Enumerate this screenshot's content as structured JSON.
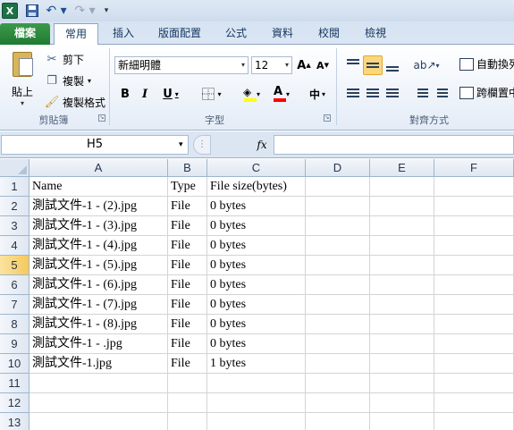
{
  "quick_access": {
    "logo_text": "X"
  },
  "tabs": [
    "檔案",
    "常用",
    "插入",
    "版面配置",
    "公式",
    "資料",
    "校閱",
    "檢視"
  ],
  "clipboard": {
    "paste_label": "貼上",
    "cut_label": "剪下",
    "copy_label": "複製",
    "format_painter_label": "複製格式",
    "group_label": "剪貼簿"
  },
  "font": {
    "name": "新細明體",
    "size": "12",
    "bold_label": "B",
    "italic_label": "I",
    "underline_label": "U",
    "grow_label": "A",
    "shrink_label": "A",
    "font_color_label": "A",
    "group_label": "字型",
    "fill_color": "#ffff00",
    "font_color": "#ff0000"
  },
  "alignment": {
    "wrap_text_label": "自動換列",
    "merge_center_label": "跨欄置中",
    "group_label": "對齊方式"
  },
  "formula_bar": {
    "name_box": "H5",
    "fx_label": "fx",
    "formula": ""
  },
  "sheet": {
    "columns": [
      "A",
      "B",
      "C",
      "D",
      "E",
      "F"
    ],
    "row_numbers": [
      "1",
      "2",
      "3",
      "4",
      "5",
      "6",
      "7",
      "8",
      "9",
      "10",
      "11",
      "12",
      "13"
    ],
    "active_row": "5",
    "rows": [
      [
        "Name",
        "Type",
        "File size(bytes)"
      ],
      [
        "測試文件-1 - (2).jpg",
        "File",
        "0 bytes"
      ],
      [
        "測試文件-1 - (3).jpg",
        "File",
        "0 bytes"
      ],
      [
        "測試文件-1 - (4).jpg",
        "File",
        "0 bytes"
      ],
      [
        "測試文件-1 - (5).jpg",
        "File",
        "0 bytes"
      ],
      [
        "測試文件-1 - (6).jpg",
        "File",
        "0 bytes"
      ],
      [
        "測試文件-1 - (7).jpg",
        "File",
        "0 bytes"
      ],
      [
        "測試文件-1 - (8).jpg",
        "File",
        "0 bytes"
      ],
      [
        "測試文件-1 - .jpg",
        "File",
        "0 bytes"
      ],
      [
        "測試文件-1.jpg",
        "File",
        "1 bytes"
      ]
    ]
  }
}
